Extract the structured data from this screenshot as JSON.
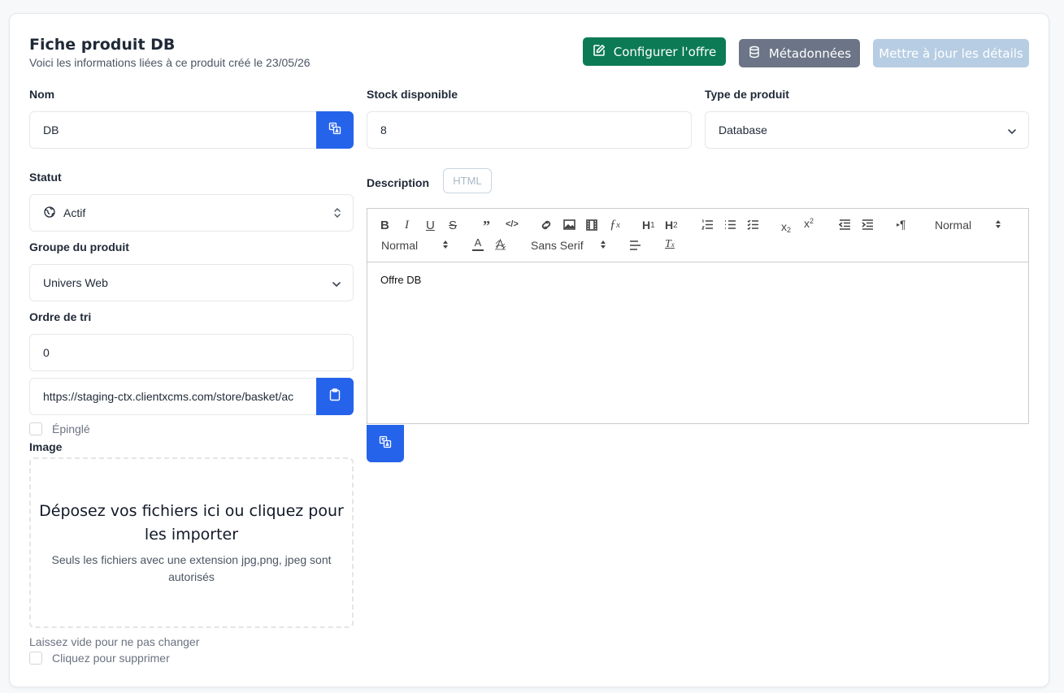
{
  "header": {
    "title": "Fiche produit DB",
    "subtitle": "Voici les informations liées à ce produit créé le 23/05/26",
    "configure_label": "Configurer l'offre",
    "metadata_label": "Métadonnées",
    "update_label": "Mettre à jour les détails"
  },
  "form": {
    "name_label": "Nom",
    "name_value": "DB",
    "stock_label": "Stock disponible",
    "stock_value": "8",
    "type_label": "Type de produit",
    "type_value": "Database",
    "status_label": "Statut",
    "status_value": "Actif",
    "group_label": "Groupe du produit",
    "group_value": "Univers Web",
    "sort_label": "Ordre de tri",
    "sort_value": "0",
    "url_value": "https://staging-ctx.clientxcms.com/store/basket/ac",
    "pinned_label": "Épinglé",
    "image_label": "Image",
    "dropzone_title": "Déposez vos fichiers ici ou cliquez pour les importer",
    "dropzone_hint": "Seuls les fichiers avec une extension jpg,png, jpeg sont autorisés",
    "keep_empty_hint": "Laissez vide pour ne pas changer",
    "delete_label": "Cliquez pour supprimer"
  },
  "description": {
    "label": "Description",
    "html_badge": "HTML",
    "header_select": "Normal",
    "size_select": "Normal",
    "font_select": "Sans Serif",
    "content": "Offre DB"
  },
  "colors": {
    "primary": "#2563eb",
    "success": "#0c7a55",
    "secondary": "#6b7587",
    "disabled": "#b7cde3"
  }
}
